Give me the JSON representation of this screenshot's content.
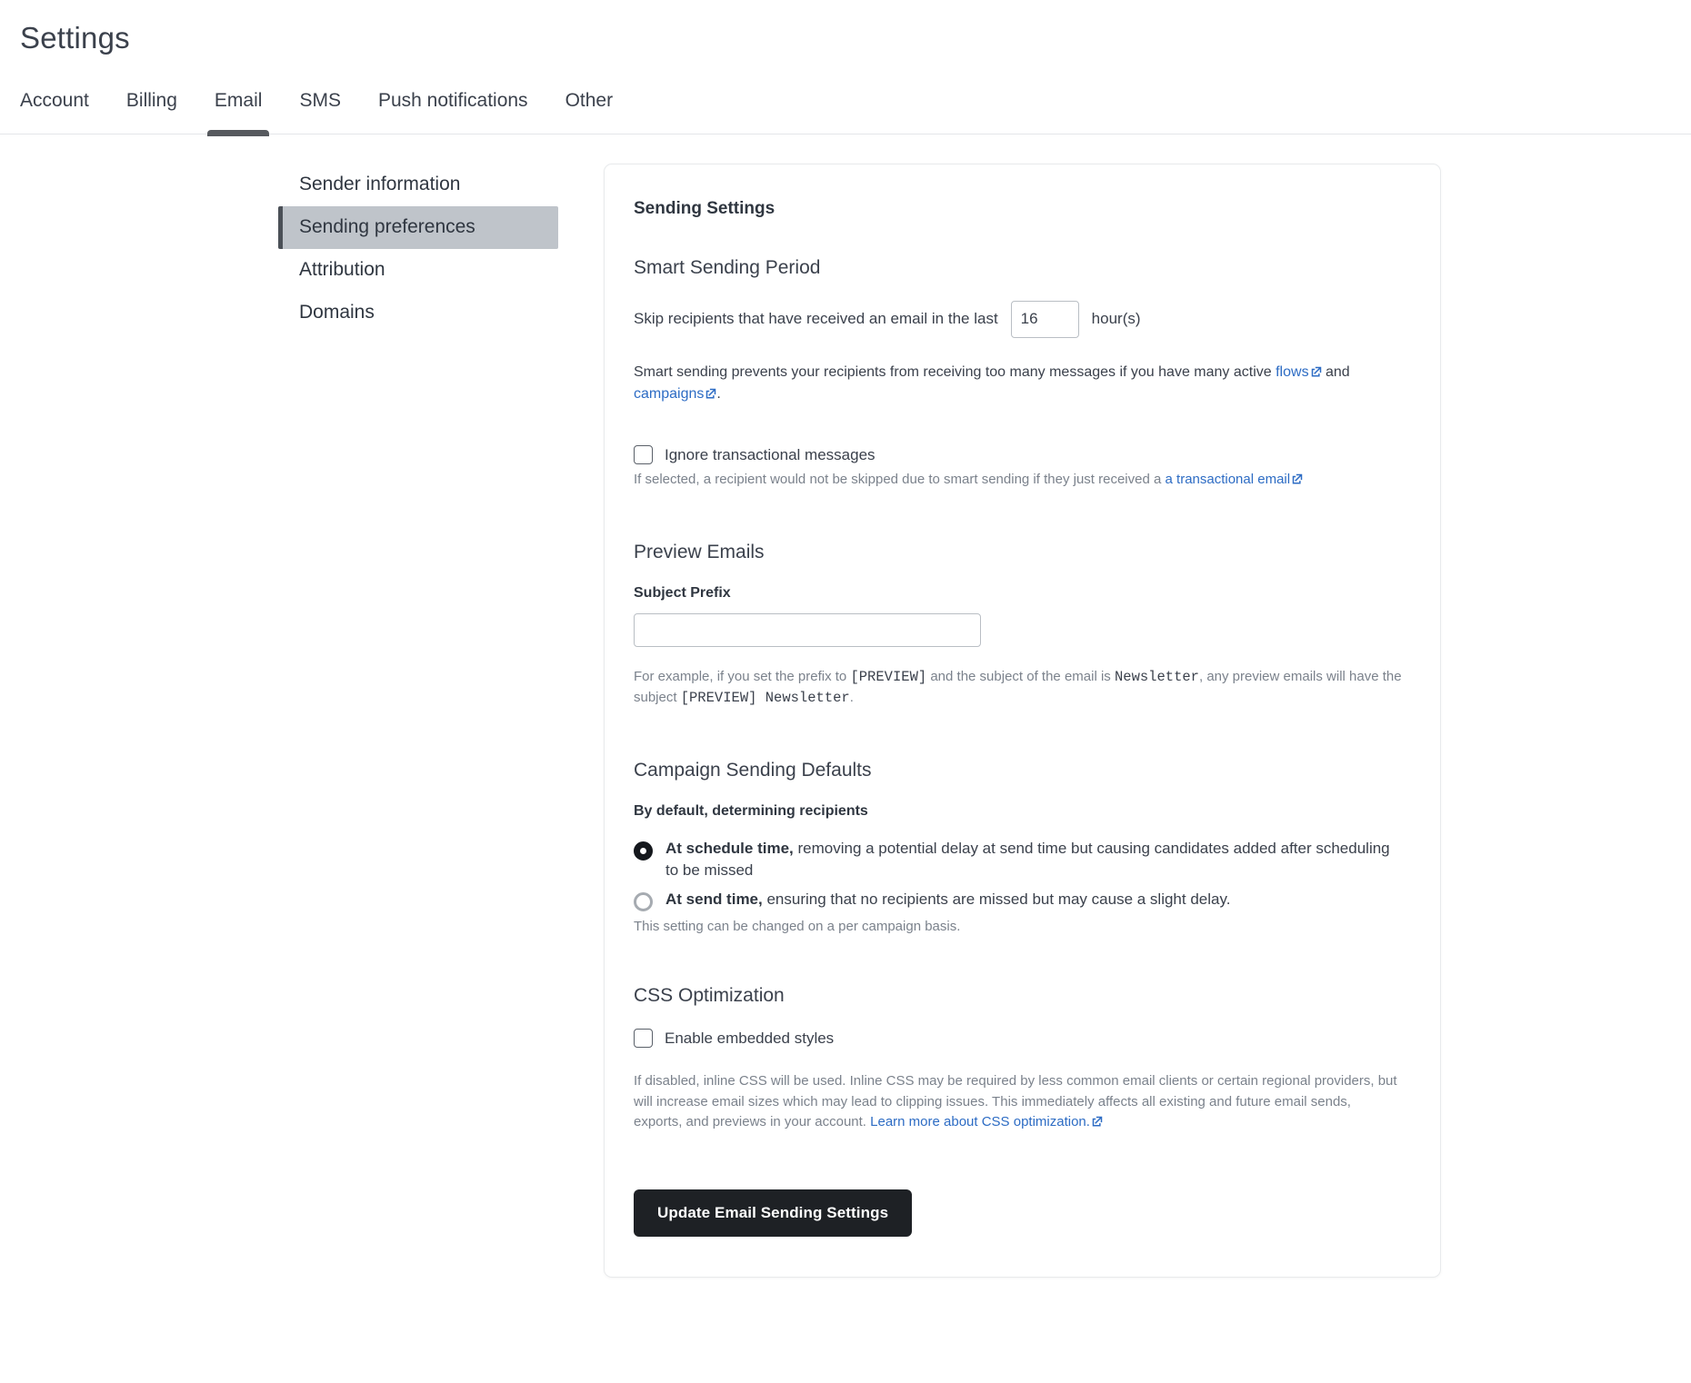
{
  "header": {
    "title": "Settings",
    "tabs": [
      {
        "label": "Account",
        "active": false
      },
      {
        "label": "Billing",
        "active": false
      },
      {
        "label": "Email",
        "active": true
      },
      {
        "label": "SMS",
        "active": false
      },
      {
        "label": "Push notifications",
        "active": false
      },
      {
        "label": "Other",
        "active": false
      }
    ]
  },
  "sidenav": {
    "items": [
      {
        "label": "Sender information",
        "active": false
      },
      {
        "label": "Sending preferences",
        "active": true
      },
      {
        "label": "Attribution",
        "active": false
      },
      {
        "label": "Domains",
        "active": false
      }
    ]
  },
  "card": {
    "title": "Sending Settings",
    "smart_sending": {
      "heading": "Smart Sending Period",
      "skip_label": "Skip recipients that have received an email in the last",
      "hours_value": "16",
      "hours_placeholder": "",
      "hours_suffix": "hour(s)",
      "description_part1": "Smart sending prevents your recipients from receiving too many messages if you have many active ",
      "link_flows": "flows",
      "description_part2": " and ",
      "link_campaigns": "campaigns",
      "description_part3": ".",
      "ignore_checkbox_label": "Ignore transactional messages",
      "ignore_checkbox_checked": false,
      "ignore_help_part1": "If selected, a recipient would not be skipped due to smart sending if they just received a ",
      "ignore_help_link": "a transactional email"
    },
    "preview_emails": {
      "heading": "Preview Emails",
      "subject_prefix_label": "Subject Prefix",
      "subject_prefix_value": "",
      "subject_prefix_placeholder": "",
      "example_part1": "For example, if you set the prefix to ",
      "example_code1": "[PREVIEW]",
      "example_part2": " and the subject of the email is ",
      "example_code2": "Newsletter",
      "example_part3": ", any preview emails will have the subject ",
      "example_code3": "[PREVIEW] Newsletter",
      "example_part4": "."
    },
    "campaign_defaults": {
      "heading": "Campaign Sending Defaults",
      "field_label": "By default, determining recipients",
      "options": [
        {
          "bold": "At schedule time,",
          "rest": " removing a potential delay at send time but causing candidates added after scheduling to be missed",
          "selected": true
        },
        {
          "bold": "At send time,",
          "rest": " ensuring that no recipients are missed but may cause a slight delay.",
          "selected": false
        }
      ],
      "note": "This setting can be changed on a per campaign basis."
    },
    "css_optimization": {
      "heading": "CSS Optimization",
      "checkbox_label": "Enable embedded styles",
      "checkbox_checked": false,
      "help_text": "If disabled, inline CSS will be used. Inline CSS may be required by less common email clients or certain regional providers, but will increase email sizes which may lead to clipping issues. This immediately affects all existing and future email sends, exports, and previews in your account. ",
      "help_link": "Learn more about CSS optimization."
    },
    "submit_label": "Update Email Sending Settings"
  },
  "colors": {
    "link": "#2d6cc4",
    "button_bg": "#1e2125",
    "active_nav_bg": "#bfc4ca",
    "tab_underline": "#56595e"
  }
}
